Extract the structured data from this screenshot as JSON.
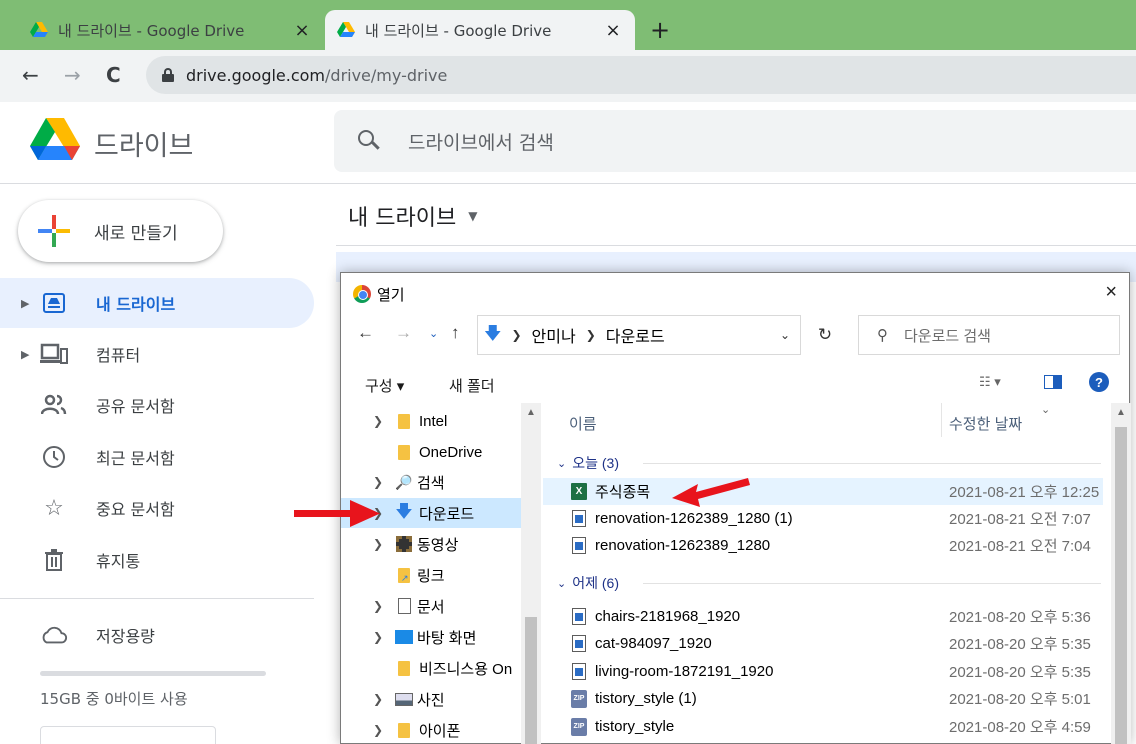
{
  "browser": {
    "tabs": [
      {
        "title": "내 드라이브 - Google Drive",
        "close": "×"
      },
      {
        "title": "내 드라이브 - Google Drive",
        "close": "×"
      }
    ],
    "new_tab": "+",
    "back": "←",
    "forward": "→",
    "reload": "C",
    "url_host": "drive.google.com",
    "url_path": "/drive/my-drive"
  },
  "drive": {
    "app_name": "드라이브",
    "search_placeholder": "드라이브에서 검색",
    "new_button": "새로 만들기",
    "page_title": "내 드라이브",
    "sidebar": [
      {
        "label": "내 드라이브",
        "icon": "my-drive-icon",
        "active": true
      },
      {
        "label": "컴퓨터",
        "icon": "computer-icon"
      },
      {
        "label": "공유 문서함",
        "icon": "shared-icon"
      },
      {
        "label": "최근 문서함",
        "icon": "clock-icon"
      },
      {
        "label": "중요 문서함",
        "icon": "star-icon"
      },
      {
        "label": "휴지통",
        "icon": "trash-icon"
      }
    ],
    "storage_label": "저장용량",
    "storage_usage": "15GB 중 0바이트 사용"
  },
  "dialog": {
    "title": "열기",
    "close": "×",
    "path": [
      "안미나",
      "다운로드"
    ],
    "search_placeholder": "다운로드 검색",
    "organize": "구성 ▾",
    "new_folder": "새 폴더",
    "help": "?",
    "nav": [
      {
        "label": "Intel",
        "expandable": true,
        "icon": "folder-icon"
      },
      {
        "label": "OneDrive",
        "expandable": false,
        "icon": "folder-icon"
      },
      {
        "label": "검색",
        "expandable": true,
        "icon": "search-folder-icon"
      },
      {
        "label": "다운로드",
        "expandable": true,
        "icon": "download-icon",
        "selected": true
      },
      {
        "label": "동영상",
        "expandable": true,
        "icon": "video-icon"
      },
      {
        "label": "링크",
        "expandable": false,
        "icon": "link-folder-icon"
      },
      {
        "label": "문서",
        "expandable": true,
        "icon": "document-icon"
      },
      {
        "label": "바탕 화면",
        "expandable": true,
        "icon": "desktop-icon"
      },
      {
        "label": "비즈니스용 On",
        "expandable": false,
        "icon": "folder-icon"
      },
      {
        "label": "사진",
        "expandable": true,
        "icon": "pictures-icon"
      },
      {
        "label": "아이폰",
        "expandable": true,
        "icon": "folder-icon"
      }
    ],
    "columns": {
      "name": "이름",
      "modified": "수정한 날짜"
    },
    "groups": [
      {
        "label": "오늘 (3)",
        "files": [
          {
            "name": "주식종목",
            "date": "2021-08-21 오후 12:25",
            "type": "excel"
          },
          {
            "name": "renovation-1262389_1280 (1)",
            "date": "2021-08-21 오전 7:07",
            "type": "image"
          },
          {
            "name": "renovation-1262389_1280",
            "date": "2021-08-21 오전 7:04",
            "type": "image"
          }
        ]
      },
      {
        "label": "어제 (6)",
        "files": [
          {
            "name": "chairs-2181968_1920",
            "date": "2021-08-20 오후 5:36",
            "type": "image"
          },
          {
            "name": "cat-984097_1920",
            "date": "2021-08-20 오후 5:35",
            "type": "image"
          },
          {
            "name": "living-room-1872191_1920",
            "date": "2021-08-20 오후 5:35",
            "type": "image"
          },
          {
            "name": "tistory_style (1)",
            "date": "2021-08-20 오후 5:01",
            "type": "zip"
          },
          {
            "name": "tistory_style",
            "date": "2021-08-20 오후 4:59",
            "type": "zip"
          }
        ]
      }
    ]
  },
  "colors": {
    "tabbar": "#7fbd74",
    "drive_active": "#1967d2",
    "annotation_arrow": "#e8141c"
  }
}
